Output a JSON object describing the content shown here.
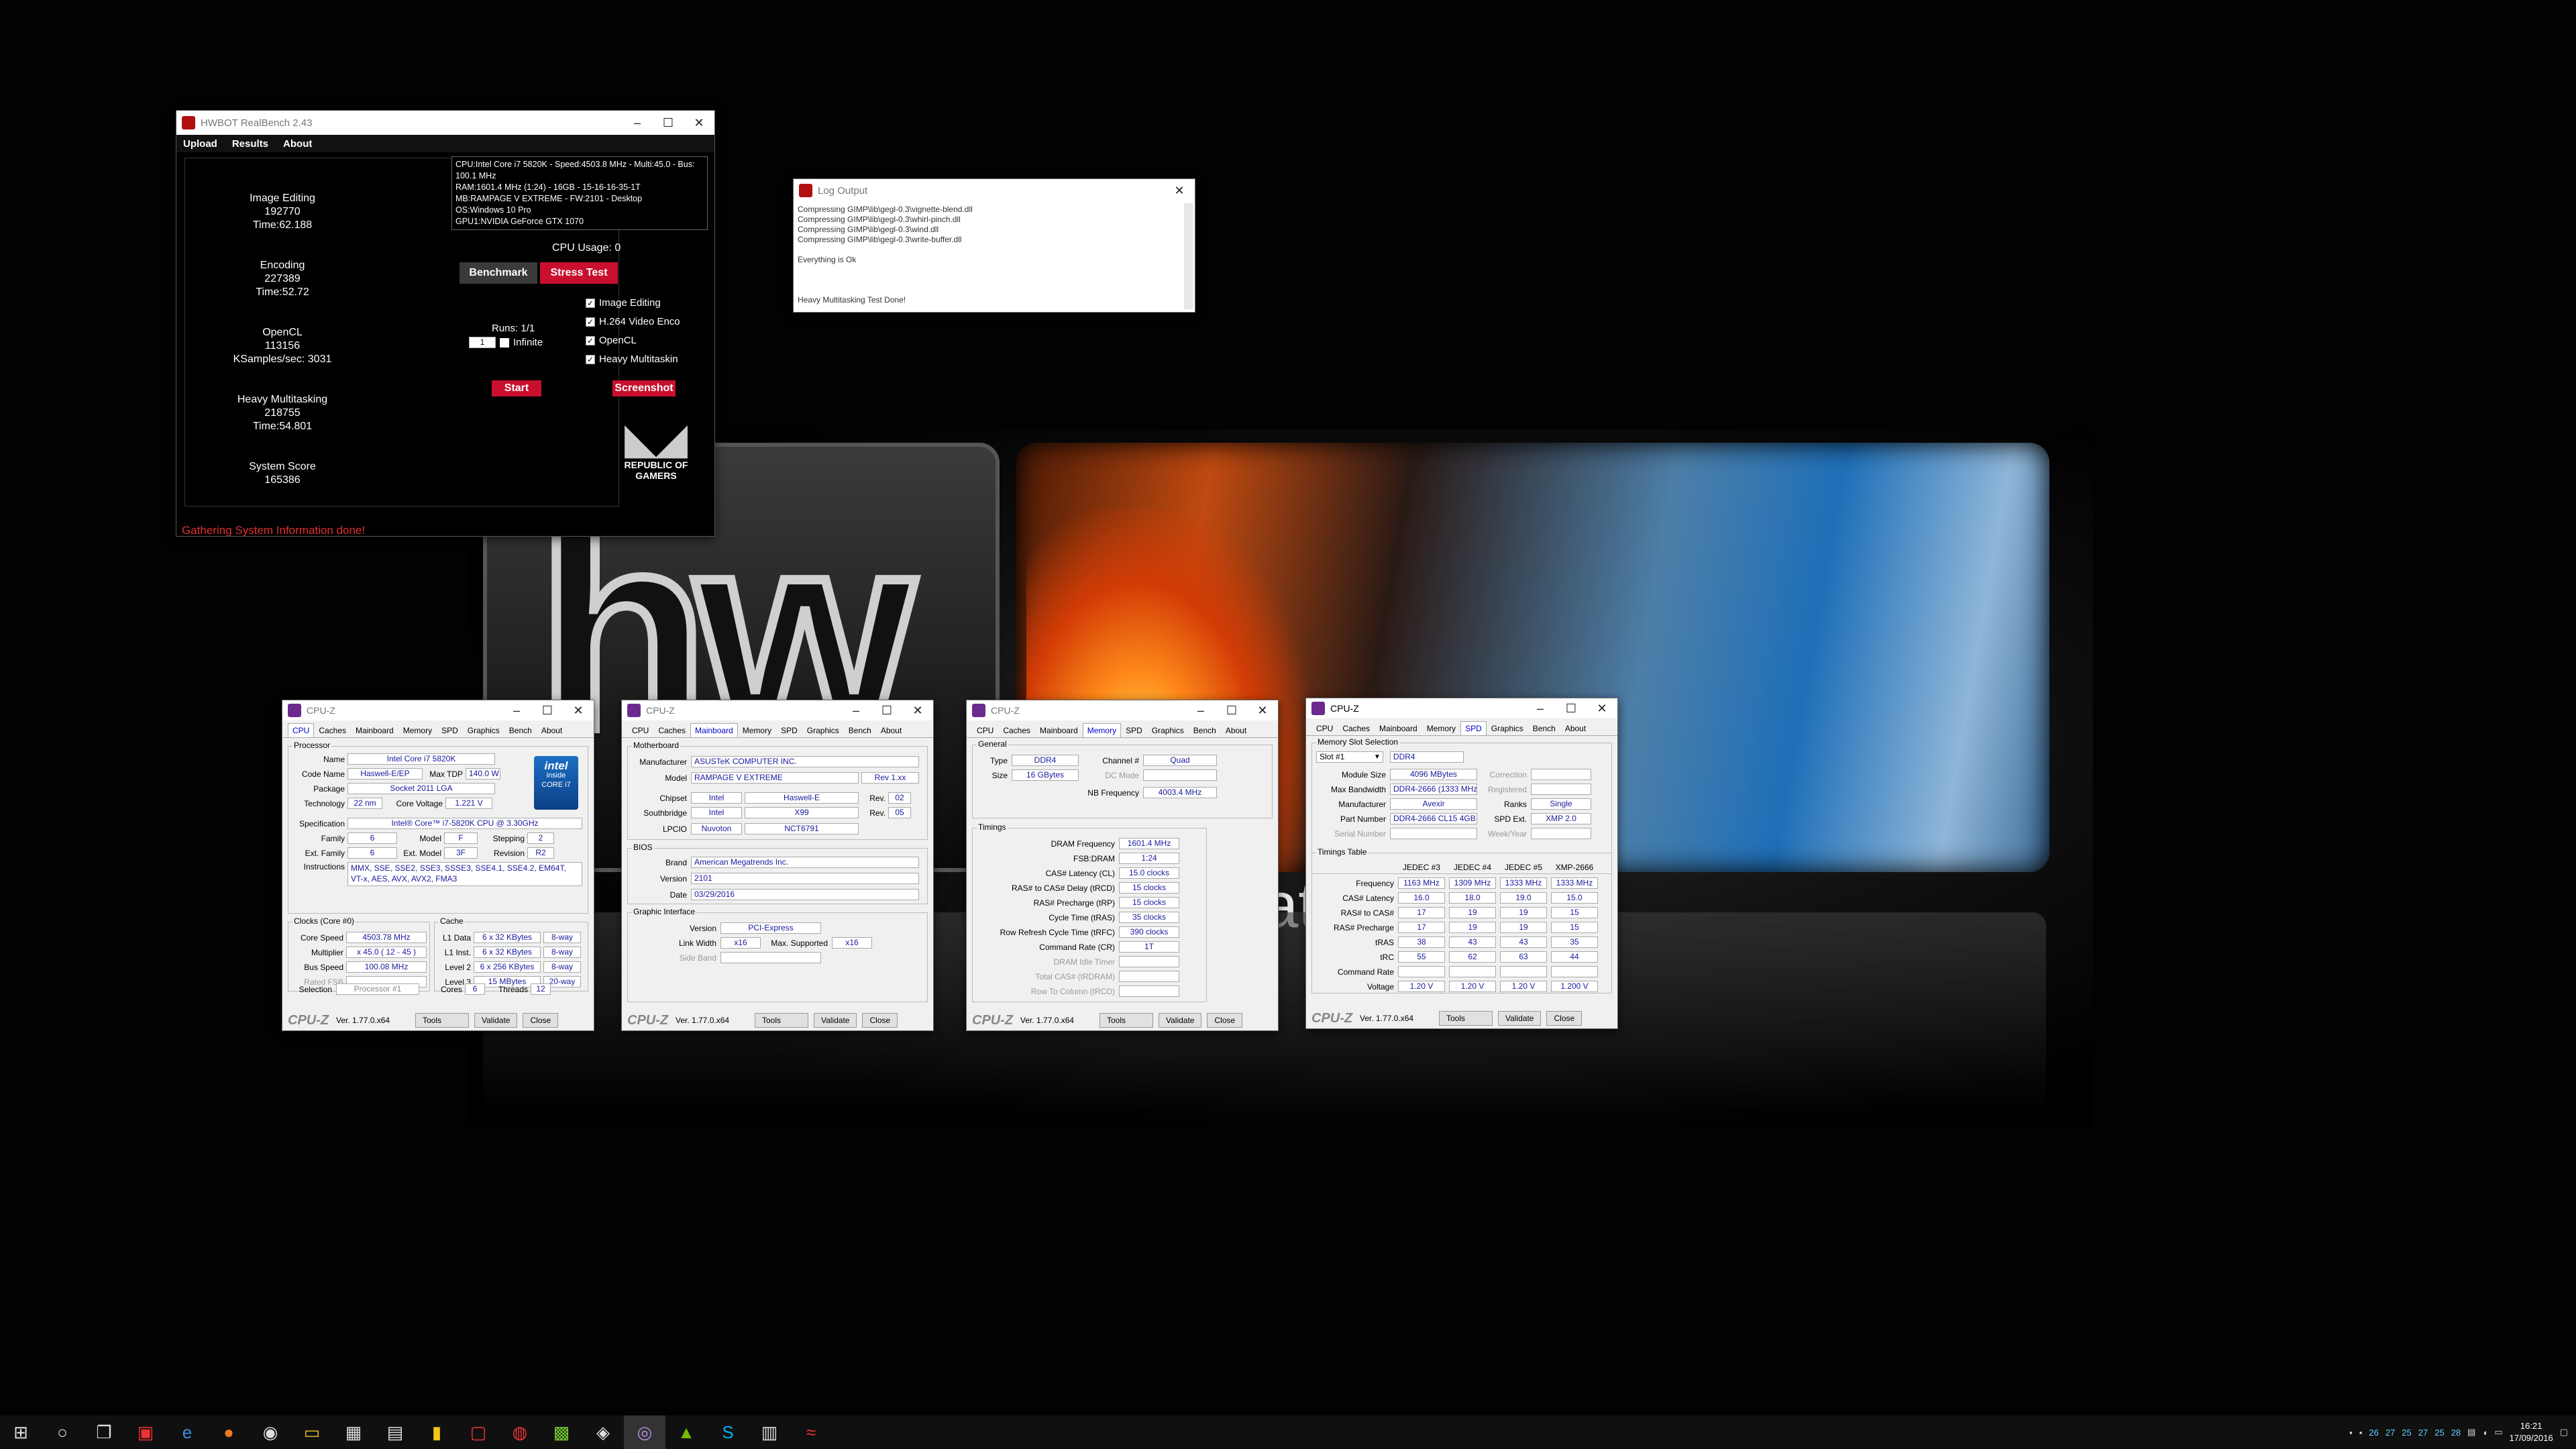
{
  "realbench": {
    "title": "HWBOT RealBench 2.43",
    "menu": [
      "Upload",
      "Results",
      "About"
    ],
    "scores": [
      {
        "name": "Image Editing",
        "value": "192770",
        "time": "Time:62.188"
      },
      {
        "name": "Encoding",
        "value": "227389",
        "time": "Time:52.72"
      },
      {
        "name": "OpenCL",
        "value": "113156",
        "time": "KSamples/sec: 3031"
      },
      {
        "name": "Heavy Multitasking",
        "value": "218755",
        "time": "Time:54.801"
      },
      {
        "name": "System Score",
        "value": "165386",
        "time": ""
      }
    ],
    "sysinfo": [
      "CPU:Intel Core i7 5820K - Speed:4503.8  MHz - Multi:45.0 - Bus: 100.1 MHz",
      "RAM:1601.4 MHz (1:24) - 16GB - 15-16-16-35-1T",
      "MB:RAMPAGE V EXTREME - FW:2101 - Desktop",
      "OS:Windows 10 Pro",
      "GPU1:NVIDIA GeForce GTX 1070"
    ],
    "cpu_usage": "CPU Usage: 0",
    "benchmark": "Benchmark",
    "stress": "Stress Test",
    "runs": "Runs: 1/1",
    "runs_value": "1",
    "infinite": "Infinite",
    "checks": [
      "Image Editing",
      "H.264 Video Enco",
      "OpenCL",
      "Heavy Multitaskin"
    ],
    "start": "Start",
    "screenshot": "Screenshot",
    "logo_text": "REPUBLIC OF GAMERS",
    "status": "Gathering System Information done!"
  },
  "log": {
    "title": "Log Output",
    "lines": [
      "Compressing  GIMP\\lib\\gegl-0.3\\vignette-blend.dll",
      "Compressing  GIMP\\lib\\gegl-0.3\\whirl-pinch.dll",
      "Compressing  GIMP\\lib\\gegl-0.3\\wind.dll",
      "Compressing  GIMP\\lib\\gegl-0.3\\write-buffer.dll",
      "",
      "Everything is Ok",
      "",
      "",
      "",
      "Heavy Multitasking Test Done!"
    ]
  },
  "wallpaper": {
    "tagline": "ration"
  },
  "cpuz_common": {
    "title": "CPU-Z",
    "version": "Ver. 1.77.0.x64",
    "tools": "Tools",
    "validate": "Validate",
    "close": "Close",
    "logo": "CPU-Z",
    "tabs": [
      "CPU",
      "Caches",
      "Mainboard",
      "Memory",
      "SPD",
      "Graphics",
      "Bench",
      "About"
    ]
  },
  "cpuz_cpu": {
    "processor_label": "Processor",
    "name": "Intel Core i7 5820K",
    "codename": "Haswell-E/EP",
    "max_tdp": "140.0 W",
    "package": "Socket 2011 LGA",
    "technology": "22 nm",
    "core_voltage": "1.221 V",
    "specification": "Intel® Core™ i7-5820K CPU @ 3.30GHz",
    "family": "6",
    "model": "F",
    "stepping": "2",
    "ext_family": "6",
    "ext_model": "3F",
    "revision": "R2",
    "instructions": "MMX, SSE, SSE2, SSE3, SSSE3, SSE4.1, SSE4.2, EM64T, VT-x, AES, AVX, AVX2, FMA3",
    "clocks_label": "Clocks (Core #0)",
    "core_speed": "4503.78 MHz",
    "multiplier": "x 45.0 ( 12 - 45 )",
    "bus_speed": "100.08 MHz",
    "rated_fsb": "Rated FSB",
    "cache_label": "Cache",
    "l1d": "6 x 32 KBytes",
    "l1d_way": "8-way",
    "l1i": "6 x 32 KBytes",
    "l1i_way": "8-way",
    "l2": "6 x 256 KBytes",
    "l2_way": "8-way",
    "l3": "15 MBytes",
    "l3_way": "20-way",
    "selection": "Processor #1",
    "cores": "6",
    "threads": "12",
    "labels": {
      "name": "Name",
      "codename": "Code Name",
      "maxtdp": "Max TDP",
      "package": "Package",
      "tech": "Technology",
      "cv": "Core Voltage",
      "spec": "Specification",
      "family": "Family",
      "model": "Model",
      "stepping": "Stepping",
      "extfam": "Ext. Family",
      "extmod": "Ext. Model",
      "rev": "Revision",
      "instr": "Instructions",
      "cs": "Core Speed",
      "mult": "Multiplier",
      "bus": "Bus Speed",
      "l1d": "L1 Data",
      "l1i": "L1 Inst.",
      "l2": "Level 2",
      "l3": "Level 3",
      "sel": "Selection",
      "cores": "Cores",
      "threads": "Threads"
    },
    "intel_badge": [
      "intel",
      "inside",
      "CORE i7"
    ]
  },
  "cpuz_mb": {
    "mb_label": "Motherboard",
    "manufacturer": "ASUSTeK COMPUTER INC.",
    "model": "RAMPAGE V EXTREME",
    "model_rev": "Rev 1.xx",
    "chipset": "Intel",
    "chipset_name": "Haswell-E",
    "chipset_rev": "02",
    "southbridge": "Intel",
    "sb_name": "X99",
    "sb_rev": "05",
    "lpcio": "Nuvoton",
    "lpcio_name": "NCT6791",
    "bios_label": "BIOS",
    "brand": "American Megatrends Inc.",
    "version": "2101",
    "date": "03/29/2016",
    "gi_label": "Graphic Interface",
    "gi_version": "PCI-Express",
    "link_width": "x16",
    "max_supported": "x16",
    "labels": {
      "manu": "Manufacturer",
      "model": "Model",
      "chipset": "Chipset",
      "sb": "Southbridge",
      "lpcio": "LPCIO",
      "rev": "Rev.",
      "brand": "Brand",
      "version": "Version",
      "date": "Date",
      "giv": "Version",
      "lw": "Link Width",
      "ms": "Max. Supported",
      "sideband": "Side Band"
    }
  },
  "cpuz_mem": {
    "general_label": "General",
    "type": "DDR4",
    "channel": "Quad",
    "size": "16 GBytes",
    "dc_mode": "DC Mode",
    "nb_freq": "4003.4 MHz",
    "timings_label": "Timings",
    "dram_freq": "1601.4 MHz",
    "fsb_dram": "1:24",
    "cl": "15.0 clocks",
    "trcd": "15 clocks",
    "trp": "15 clocks",
    "tras": "35 clocks",
    "trfc": "390 clocks",
    "cr": "1T",
    "labels": {
      "type": "Type",
      "size": "Size",
      "channel": "Channel #",
      "nb": "NB Frequency",
      "dram": "DRAM Frequency",
      "fsb": "FSB:DRAM",
      "cl": "CAS# Latency (CL)",
      "trcd": "RAS# to CAS# Delay (tRCD)",
      "trp": "RAS# Precharge (tRP)",
      "tras": "Cycle Time (tRAS)",
      "trfc": "Row Refresh Cycle Time (tRFC)",
      "cr": "Command Rate (CR)",
      "idle": "DRAM Idle Timer",
      "tcas": "Total CAS# (tRDRAM)",
      "rtc": "Row To Column (tRCD)"
    }
  },
  "cpuz_spd": {
    "slot_label": "Memory Slot Selection",
    "slot": "Slot #1",
    "type": "DDR4",
    "module_size": "4096 MBytes",
    "max_bw": "DDR4-2666 (1333 MHz)",
    "manufacturer": "Avexir",
    "ranks": "Single",
    "part": "DDR4-2666 CL15 4GB",
    "spd_ext": "XMP 2.0",
    "labels": {
      "ms": "Module Size",
      "mb": "Max Bandwidth",
      "manu": "Manufacturer",
      "pn": "Part Number",
      "sn": "Serial Number",
      "corr": "Correction",
      "reg": "Registered",
      "ranks": "Ranks",
      "spdext": "SPD Ext.",
      "wy": "Week/Year"
    },
    "table_label": "Timings Table",
    "cols": [
      "JEDEC #3",
      "JEDEC #4",
      "JEDEC #5",
      "XMP-2666"
    ],
    "rows": [
      {
        "name": "Frequency",
        "vals": [
          "1163 MHz",
          "1309 MHz",
          "1333 MHz",
          "1333 MHz"
        ]
      },
      {
        "name": "CAS# Latency",
        "vals": [
          "16.0",
          "18.0",
          "19.0",
          "15.0"
        ]
      },
      {
        "name": "RAS# to CAS#",
        "vals": [
          "17",
          "19",
          "19",
          "15"
        ]
      },
      {
        "name": "RAS# Precharge",
        "vals": [
          "17",
          "19",
          "19",
          "15"
        ]
      },
      {
        "name": "tRAS",
        "vals": [
          "38",
          "43",
          "43",
          "35"
        ]
      },
      {
        "name": "tRC",
        "vals": [
          "55",
          "62",
          "63",
          "44"
        ]
      },
      {
        "name": "Command Rate",
        "vals": [
          "",
          "",
          "",
          ""
        ]
      },
      {
        "name": "Voltage",
        "vals": [
          "1.20 V",
          "1.20 V",
          "1.20 V",
          "1.200 V"
        ]
      }
    ]
  },
  "taskbar": {
    "tray_nums": [
      "26",
      "27",
      "25",
      "27",
      "25",
      "28"
    ],
    "time": "16:21",
    "date": "17/09/2016"
  }
}
